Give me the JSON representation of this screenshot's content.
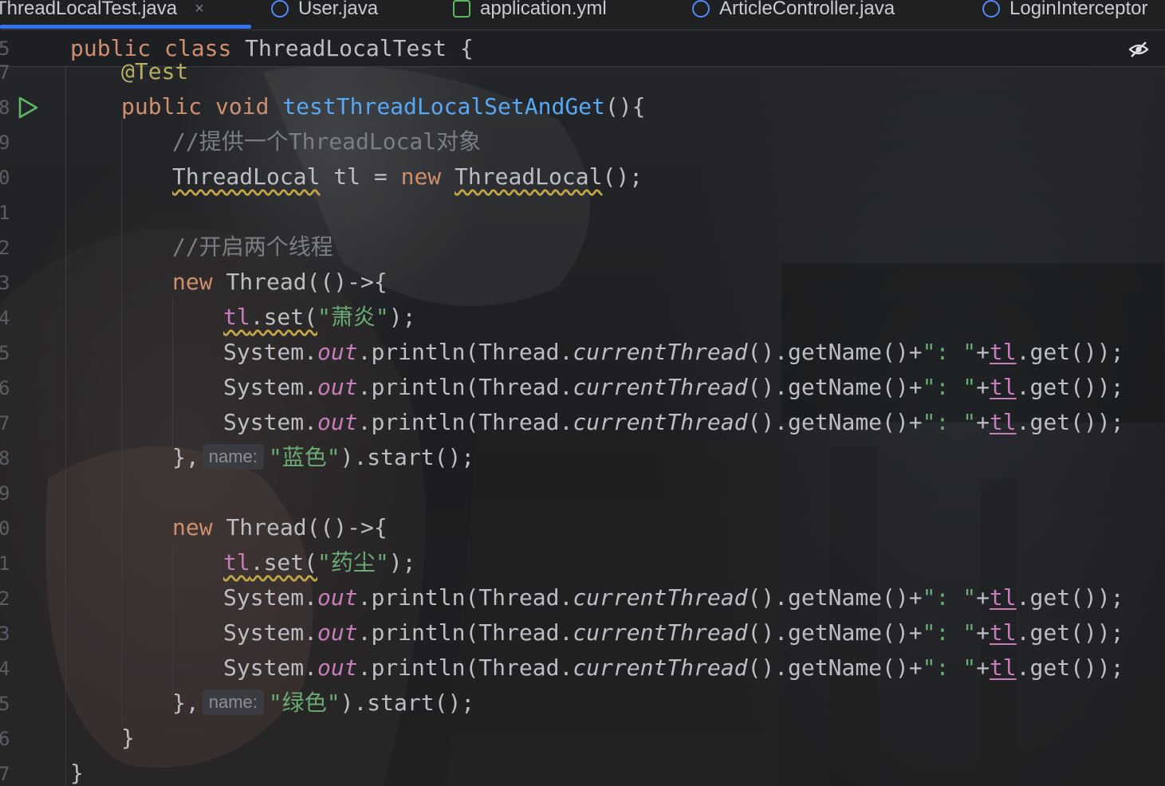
{
  "tabs": [
    {
      "label": "ThreadLocalTest.java",
      "icon": "java-class-icon",
      "active": true
    },
    {
      "label": "User.java",
      "icon": "java-class-icon",
      "active": false
    },
    {
      "label": "application.yml",
      "icon": "yml-file-icon",
      "active": false
    },
    {
      "label": "ArticleController.java",
      "icon": "java-class-icon",
      "active": false
    },
    {
      "label": "LoginInterceptor",
      "icon": "java-class-icon",
      "active": false
    }
  ],
  "tab_close_glyph": "×",
  "sticky_header": {
    "line_number": "5",
    "kw_public": "public",
    "kw_class": "class",
    "class_name": "ThreadLocalTest",
    "brace": "{"
  },
  "gutter": [
    "7",
    "8",
    "9",
    "0",
    "1",
    "2",
    "3",
    "4",
    "5",
    "6",
    "7",
    "8",
    "9",
    "0",
    "1",
    "2",
    "3",
    "4",
    "5",
    "6",
    "7"
  ],
  "code": {
    "annotation": "@Test",
    "method": {
      "kw_public": "public",
      "kw_void": "void",
      "name": "testThreadLocalSetAndGet",
      "tail": "(){"
    },
    "comment_create": "//提供一个ThreadLocal对象",
    "decl": {
      "type": "ThreadLocal",
      "var": " tl = ",
      "kw_new": "new",
      "ctor": "ThreadLocal",
      "tail": "();"
    },
    "comment_threads": "//开启两个线程",
    "kw_new": "new",
    "thread_open": "Thread(()->{",
    "tl": "tl",
    "set_open": ".set(",
    "set_close": ");",
    "print": {
      "system": "System.",
      "out": "out",
      "println": ".println(Thread.",
      "current_thread": "currentThread",
      "get_name": "().getName()+",
      "sep": "\": \"",
      "plus": "+",
      "tl": "tl",
      "get_tail": ".get());"
    },
    "thread_close": "},",
    "hint_name": "name:",
    "start_tail": ").start();",
    "thread1": {
      "value": "\"萧炎\"",
      "name": "\"蓝色\""
    },
    "thread2": {
      "value": "\"药尘\"",
      "name": "\"绿色\""
    },
    "method_close": "}",
    "class_close": "}"
  },
  "colors": {
    "keyword": "#cf8e6d",
    "function": "#56a8f5",
    "string": "#6aab73",
    "comment": "#7a7e85",
    "field": "#c77dbb",
    "annotation": "#b3ae60",
    "accent": "#3574f0"
  },
  "icons": {
    "run": "run-gutter-icon",
    "reader_mode": "eye-slash-icon"
  }
}
